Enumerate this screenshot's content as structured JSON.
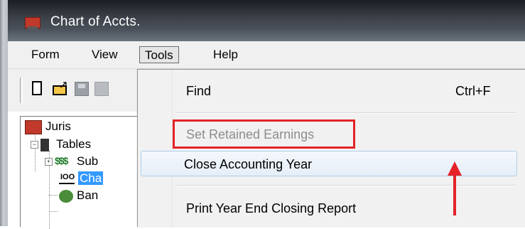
{
  "window": {
    "title": "Chart of Accts.",
    "icon": "juris-app-icon"
  },
  "menubar": {
    "items": [
      "Form",
      "View",
      "Tools",
      "Help"
    ],
    "active": "Tools"
  },
  "toolbar": {
    "icons": [
      "new-document-icon",
      "open-folder-icon",
      "save-disk-icon",
      "disabled-button-icon"
    ]
  },
  "tree": {
    "root": "Juris",
    "tables": "Tables",
    "sub": "Sub",
    "chart": "Cha",
    "bank": "Ban"
  },
  "tools_menu": {
    "items": [
      {
        "label": "Find",
        "shortcut": "Ctrl+F",
        "state": "normal"
      },
      {
        "label": "Set Retained Earnings",
        "shortcut": "",
        "state": "disabled"
      },
      {
        "label": "Close Accounting Year",
        "shortcut": "",
        "state": "hover"
      },
      {
        "label": "Print Year End Closing Report",
        "shortcut": "",
        "state": "normal"
      }
    ]
  },
  "annotations": {
    "color": "#e42227",
    "box_target": "Set Retained Earnings",
    "arrow_target": "Close Accounting Year"
  }
}
